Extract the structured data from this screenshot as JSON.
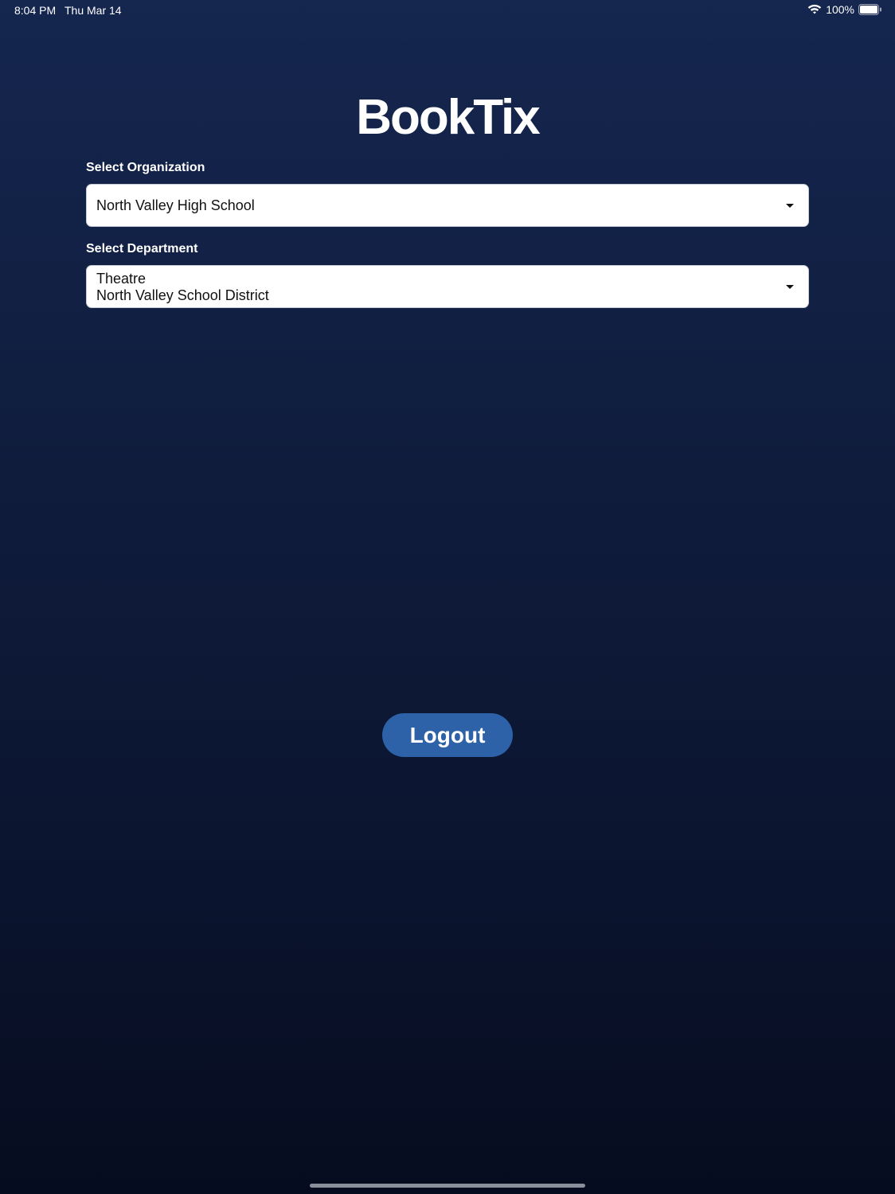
{
  "status_bar": {
    "time": "8:04 PM",
    "date": "Thu Mar 14",
    "battery": "100%",
    "icons": [
      "wifi-icon",
      "battery-icon"
    ]
  },
  "app": {
    "logo_text": "BookTix"
  },
  "organization": {
    "label": "Select Organization",
    "selected_value": "North Valley High School"
  },
  "department": {
    "label": "Select Department",
    "selected_name": "Theatre",
    "selected_district": "North Valley School District"
  },
  "actions": {
    "logout_label": "Logout"
  },
  "colors": {
    "background_top": "#15264f",
    "background_bottom": "#060c1f",
    "button": "#2d62a8"
  }
}
